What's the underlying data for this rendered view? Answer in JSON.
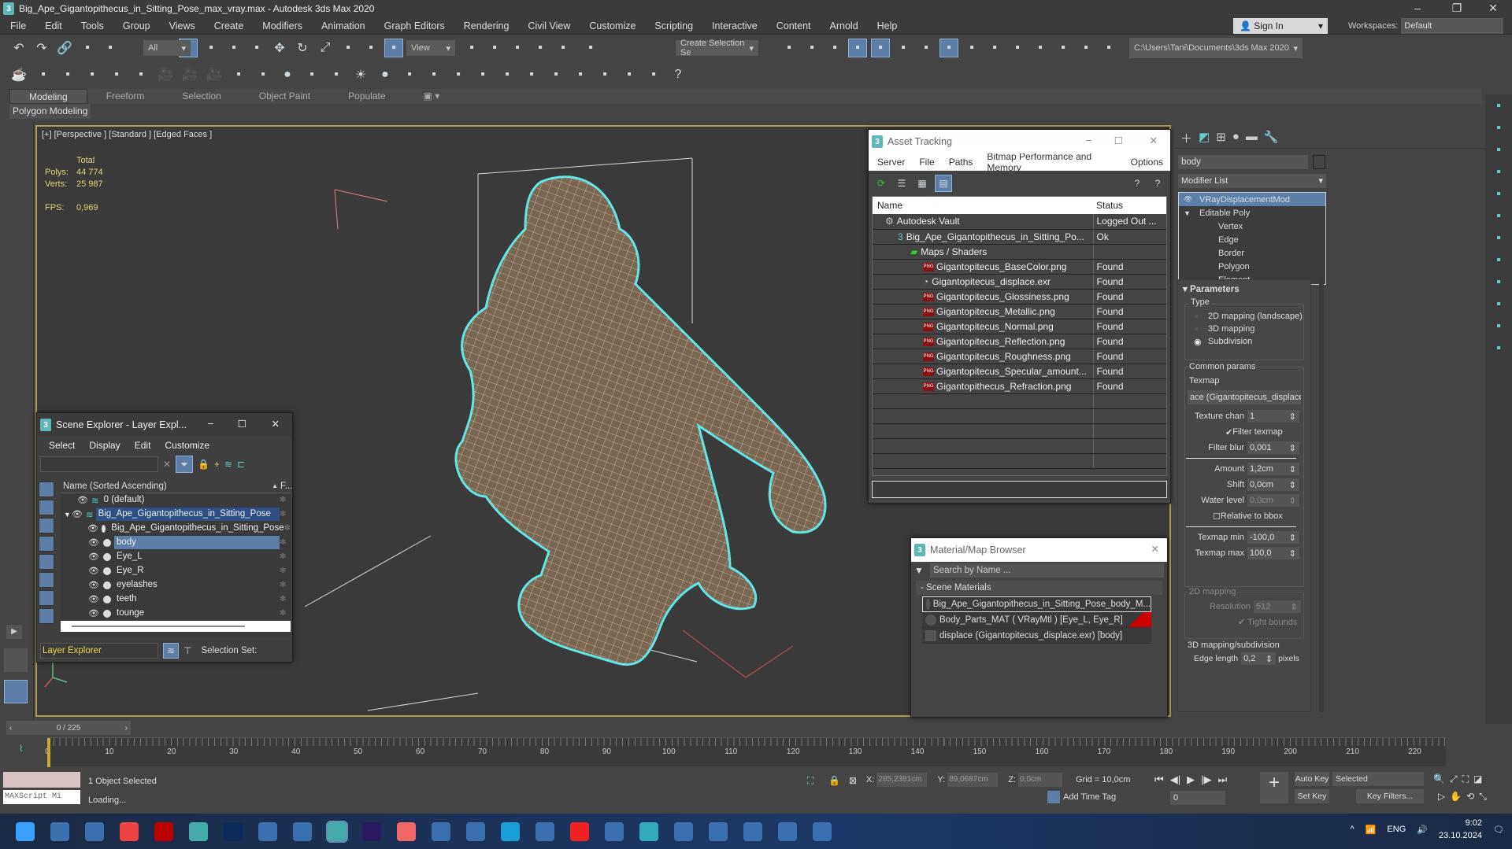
{
  "app": {
    "title": "Big_Ape_Gigantopithecus_in_Sitting_Pose_max_vray.max - Autodesk 3ds Max 2020"
  },
  "menu": [
    "File",
    "Edit",
    "Tools",
    "Group",
    "Views",
    "Create",
    "Modifiers",
    "Animation",
    "Graph Editors",
    "Rendering",
    "Civil View",
    "Customize",
    "Scripting",
    "Interactive",
    "Content",
    "Arnold",
    "Help"
  ],
  "account": {
    "sign_in": "Sign In",
    "workspaces_label": "Workspaces:",
    "workspace": "Default"
  },
  "toolbar": {
    "filter": "All",
    "ref_coord": "View",
    "selection_set": "Create Selection Se",
    "project_path": "C:\\Users\\Tani\\Documents\\3ds Max 2020",
    "icons1": [
      "undo-icon",
      "redo-icon",
      "link-icon",
      "unlink-icon",
      "bind-spacewarp-icon",
      "select-object-icon",
      "select-by-name-icon",
      "rect-selection-icon",
      "window-crossing-icon",
      "move-icon",
      "rotate-icon",
      "scale-icon",
      "placement-icon",
      "pivot-icon",
      "select-manipulate-icon",
      "keyboard-shortcut-icon",
      "snap-3d-icon",
      "angle-snap-icon",
      "percent-snap-icon",
      "spinner-snap-icon",
      "named-selection-icon"
    ],
    "icons2": [
      "mirror-icon",
      "align-icon",
      "scene-explorer-icon",
      "layer-explorer-icon",
      "toggle-ribbon-icon",
      "curve-editor-icon",
      "dope-sheet-icon",
      "material-editor-icon",
      "render-setup-icon",
      "rendered-frame-icon",
      "render-icon",
      "render-cloud-icon",
      "a360-gallery-icon",
      "project-folder-icon",
      "set-project-icon",
      "project-tree-icon",
      "project-config-icon"
    ],
    "icons3": [
      "teapot-icon",
      "cloud-icon",
      "render-env-icon",
      "list-icon",
      "settings-icon",
      "light-lister-icon",
      "camera-icon",
      "camera-2-icon",
      "camera-3-icon",
      "plane-light-icon",
      "dome-light-icon",
      "sphere-light-icon",
      "ies-light-icon",
      "spot-icon",
      "sun-icon",
      "sphere-icon",
      "fur-icon",
      "physics-icon",
      "proxy-icon",
      "ball-icon",
      "grass-icon",
      "hair-icon",
      "ox-icon",
      "material-ball-icon",
      "vfb-icon",
      "render-region-icon",
      "toolbar-icon",
      "help-icon"
    ]
  },
  "ribbon": {
    "tabs": [
      "Modeling",
      "Freeform",
      "Selection",
      "Object Paint",
      "Populate"
    ],
    "active": 0,
    "panel": "Polygon Modeling"
  },
  "viewport": {
    "label": "[+] [Perspective ] [Standard ] [Edged Faces ]",
    "stats": {
      "header": "Total",
      "polys_label": "Polys:",
      "polys": "44 774",
      "verts_label": "Verts:",
      "verts": "25 987",
      "fps_label": "FPS:",
      "fps": "0,969"
    },
    "wire_color": "#5ee6e6"
  },
  "asset_tracking": {
    "title": "Asset Tracking",
    "menu": [
      "Server",
      "File",
      "Paths",
      "Bitmap Performance and Memory",
      "Options"
    ],
    "columns": [
      "Name",
      "Status"
    ],
    "rows": [
      {
        "name": "Autodesk Vault",
        "status": "Logged Out ...",
        "indent": 1,
        "icon": "vault"
      },
      {
        "name": "Big_Ape_Gigantopithecus_in_Sitting_Po...",
        "status": "Ok",
        "indent": 2,
        "icon": "max"
      },
      {
        "name": "Maps / Shaders",
        "status": "",
        "indent": 3,
        "icon": "maps"
      },
      {
        "name": "Gigantopitecus_BaseColor.png",
        "status": "Found",
        "indent": 4,
        "icon": "png"
      },
      {
        "name": "Gigantopitecus_displace.exr",
        "status": "Found",
        "indent": 4,
        "icon": "exr"
      },
      {
        "name": "Gigantopitecus_Glossiness.png",
        "status": "Found",
        "indent": 4,
        "icon": "png"
      },
      {
        "name": "Gigantopitecus_Metallic.png",
        "status": "Found",
        "indent": 4,
        "icon": "png"
      },
      {
        "name": "Gigantopitecus_Normal.png",
        "status": "Found",
        "indent": 4,
        "icon": "png"
      },
      {
        "name": "Gigantopitecus_Reflection.png",
        "status": "Found",
        "indent": 4,
        "icon": "png"
      },
      {
        "name": "Gigantopitecus_Roughness.png",
        "status": "Found",
        "indent": 4,
        "icon": "png"
      },
      {
        "name": "Gigantopitecus_Specular_amount...",
        "status": "Found",
        "indent": 4,
        "icon": "png"
      },
      {
        "name": "Gigantopithecus_Refraction.png",
        "status": "Found",
        "indent": 4,
        "icon": "png"
      }
    ]
  },
  "scene_explorer": {
    "title": "Scene Explorer - Layer Expl...",
    "menu": [
      "Select",
      "Display",
      "Edit",
      "Customize"
    ],
    "column": "Name (Sorted Ascending)",
    "column2": "F...",
    "rows": [
      {
        "name": "0 (default)",
        "level": 0,
        "selected": false
      },
      {
        "name": "Big_Ape_Gigantopithecus_in_Sitting_Pose",
        "level": 0,
        "selected": "dark"
      },
      {
        "name": "Big_Ape_Gigantopithecus_in_Sitting_Pose",
        "level": 1,
        "selected": false
      },
      {
        "name": "body",
        "level": 1,
        "selected": true
      },
      {
        "name": "Eye_L",
        "level": 1,
        "selected": false
      },
      {
        "name": "Eye_R",
        "level": 1,
        "selected": false
      },
      {
        "name": "eyelashes",
        "level": 1,
        "selected": false
      },
      {
        "name": "teeth",
        "level": 1,
        "selected": false
      },
      {
        "name": "tounge",
        "level": 1,
        "selected": false
      }
    ],
    "footer_mode": "Layer Explorer",
    "selection_set": "Selection Set:"
  },
  "material_browser": {
    "title": "Material/Map Browser",
    "search_placeholder": "Search by Name ...",
    "group": "- Scene Materials",
    "items": [
      "Big_Ape_Gigantopithecus_in_Sitting_Pose_body_M...",
      "Body_Parts_MAT  ( VRayMtl )  [Eye_L, Eye_R]",
      "displace (Gigantopitecus_displace.exr) [body]"
    ]
  },
  "command_panel": {
    "object_name": "body",
    "modifier_list": "Modifier List",
    "stack": [
      {
        "name": "VRayDisplacementMod",
        "level": 0,
        "selected": true
      },
      {
        "name": "Editable Poly",
        "level": 0,
        "selected": false
      },
      {
        "name": "Vertex",
        "level": 1
      },
      {
        "name": "Edge",
        "level": 1
      },
      {
        "name": "Border",
        "level": 1
      },
      {
        "name": "Polygon",
        "level": 1
      },
      {
        "name": "Element",
        "level": 1
      }
    ],
    "rollout": "Parameters",
    "type_label": "Type",
    "type_options": [
      "2D mapping (landscape)",
      "3D mapping",
      "Subdivision"
    ],
    "type_selected": 2,
    "common": "Common params",
    "texmap_label": "Texmap",
    "texmap": "ace (Gigantopitecus_displace.",
    "fields": [
      {
        "label": "Texture chan",
        "value": "1"
      },
      {
        "label": "Filter blur",
        "value": "0,001"
      },
      {
        "label": "Amount",
        "value": "1,2cm"
      },
      {
        "label": "Shift",
        "value": "0,0cm"
      },
      {
        "label": "Water level",
        "value": "0,0cm"
      },
      {
        "label": "Texmap min",
        "value": "-100,0"
      },
      {
        "label": "Texmap max",
        "value": "100,0"
      }
    ],
    "filter_texmap": "Filter texmap",
    "relative_bbox": "Relative to bbox",
    "map2d": "2D mapping",
    "resolution_label": "Resolution",
    "resolution": "512",
    "tight_bounds": "Tight bounds",
    "map3d": "3D mapping/subdivision",
    "edge_length": "Edge length",
    "edge_value": "0,2",
    "pixels": "pixels"
  },
  "timeline": {
    "frame": "0 / 225",
    "current": 0,
    "total": 225,
    "ticks": [
      0,
      10,
      20,
      30,
      40,
      50,
      60,
      70,
      80,
      90,
      100,
      110,
      120,
      130,
      140,
      150,
      160,
      170,
      180,
      190,
      200,
      210,
      220
    ]
  },
  "status": {
    "selected": "1 Object Selected",
    "loading": "Loading...",
    "maxscript": "MAXScript Mi",
    "x_label": "X:",
    "x": "285,2381cm",
    "y_label": "Y:",
    "y": "89,0687cm",
    "z_label": "Z:",
    "z": "0,0cm",
    "grid": "Grid = 10,0cm",
    "add_time_tag": "Add Time Tag",
    "auto_key": "Auto Key",
    "set_key": "Set Key",
    "key_mode": "Selected",
    "key_filters": "Key Filters...",
    "frame_field": "0"
  },
  "taskbar": {
    "apps": [
      "start",
      "explorer",
      "task-view",
      "chrome",
      "aida64",
      "3dsmax",
      "photoshop",
      "app",
      "notepad",
      "3dsmax-active",
      "after-effects",
      "grammarly",
      "app2",
      "floppy",
      "edge",
      "app3",
      "yandex",
      "terminal",
      "telegram",
      "calculator",
      "app4",
      "monitor",
      "settings",
      "camera"
    ],
    "lang": "ENG",
    "time": "9:02",
    "date": "23.10.2024"
  }
}
